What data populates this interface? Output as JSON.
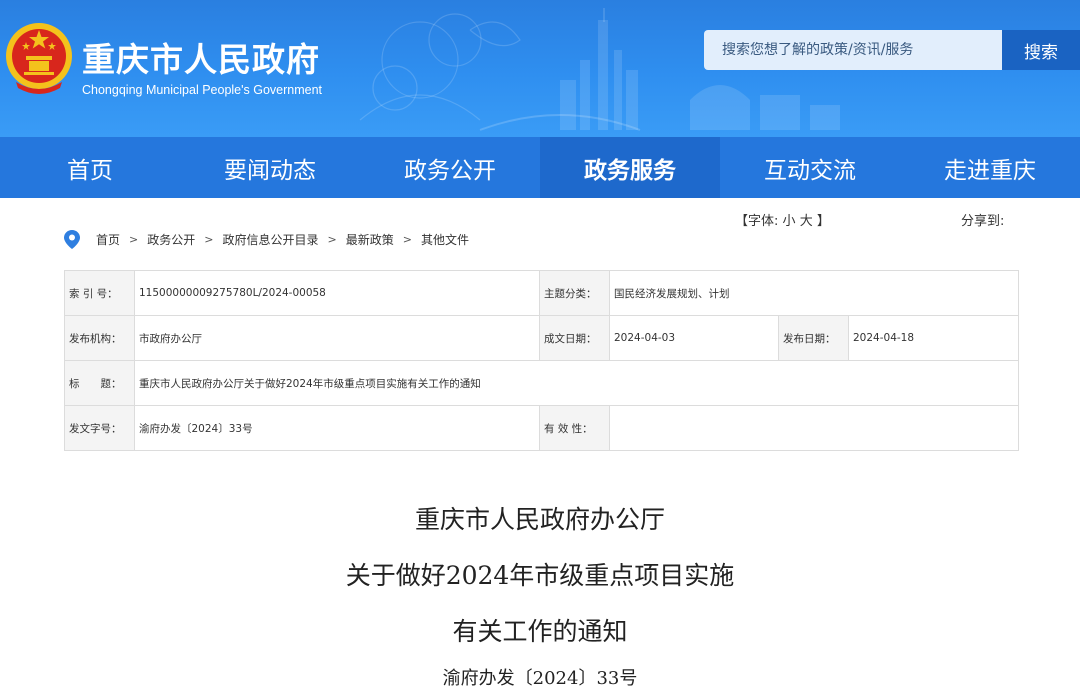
{
  "header": {
    "site_title": "重庆市人民政府",
    "site_subtitle": "Chongqing Municipal People's Government",
    "search_placeholder": "搜索您想了解的政策/资讯/服务",
    "search_button": "搜索",
    "emblem_icon": "national-emblem-icon",
    "colors": {
      "banner": "#2f8ff0",
      "nav": "#2577dd",
      "nav_active": "#1e69cc",
      "search_button": "#1a63c2"
    }
  },
  "nav": {
    "items": [
      {
        "label": "首页"
      },
      {
        "label": "要闻动态"
      },
      {
        "label": "政务公开"
      },
      {
        "label": "政务服务",
        "active": true
      },
      {
        "label": "互动交流"
      },
      {
        "label": "走进重庆"
      }
    ]
  },
  "toolbar": {
    "font_prefix": "【字体:",
    "font_small": "小",
    "font_large": "大",
    "font_suffix": "】",
    "share_label": "分享到:"
  },
  "breadcrumb": {
    "icon": "location-pin-icon",
    "items": [
      "首页",
      "政务公开",
      "政府信息公开目录",
      "最新政策",
      "其他文件"
    ],
    "separator": ">"
  },
  "info": {
    "index_label": "索 引 号：",
    "index_value": "11500000009275780L/2024-00058",
    "topic_label": "主题分类：",
    "topic_value": "国民经济发展规划、计划",
    "publisher_label": "发布机构：",
    "publisher_value": "市政府办公厅",
    "written_date_label": "成文日期：",
    "written_date_value": "2024-04-03",
    "release_date_label": "发布日期：",
    "release_date_value": "2024-04-18",
    "title_label": "标　　题：",
    "title_value": "重庆市人民政府办公厅关于做好2024年市级重点项目实施有关工作的通知",
    "doc_no_label": "发文字号：",
    "doc_no_value": "渝府办发〔2024〕33号",
    "validity_label": "有 效 性：",
    "validity_value": ""
  },
  "document": {
    "title_line1": "重庆市人民政府办公厅",
    "title_line2": "关于做好2024年市级重点项目实施",
    "title_line3": "有关工作的通知",
    "doc_number": "渝府办发〔2024〕33号"
  }
}
